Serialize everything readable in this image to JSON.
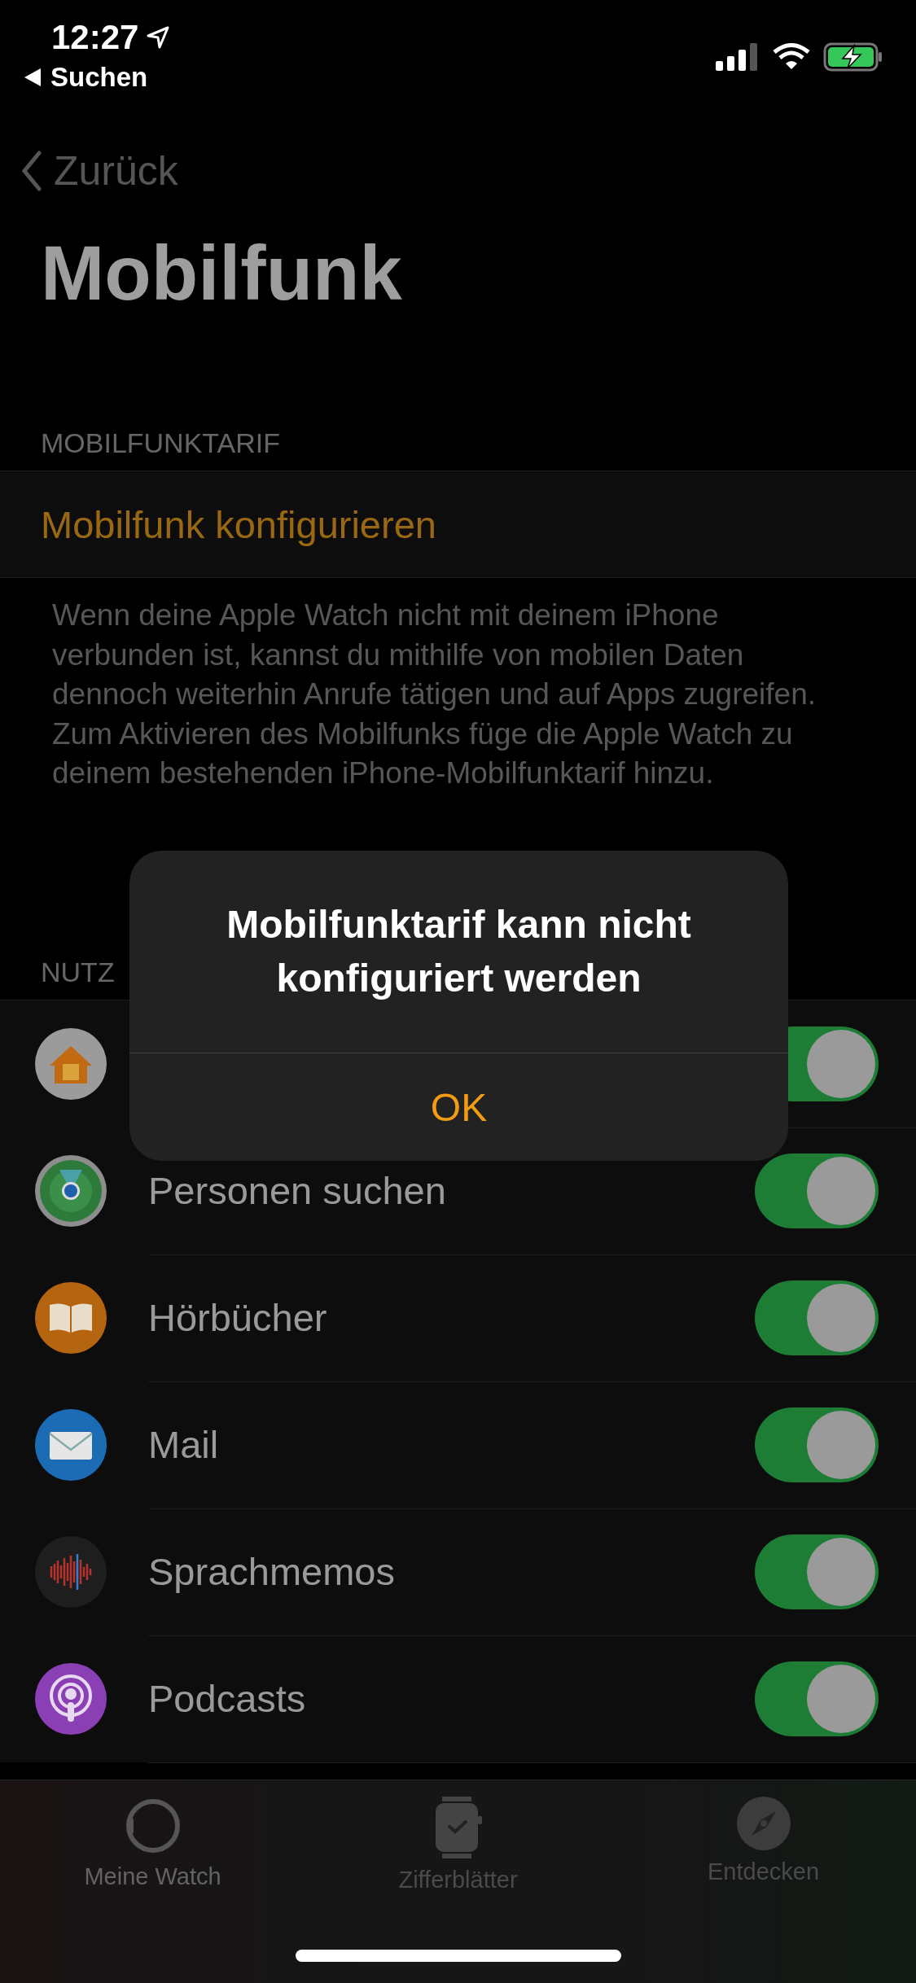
{
  "status_bar": {
    "time": "12:27",
    "back_app": "Suchen"
  },
  "nav": {
    "back": "Zurück"
  },
  "title": "Mobilfunk",
  "plan_section": {
    "header": "MOBILFUNKTARIF",
    "action": "Mobilfunk konfigurieren",
    "footer": "Wenn deine Apple Watch nicht mit deinem iPhone verbunden ist, kannst du mithilfe von mobilen Daten dennoch weiterhin Anrufe tätigen und auf Apps zugreifen. Zum Aktivieren des Mobilfunks füge die Apple Watch zu deinem bestehenden iPhone-Mobilfunktarif hinzu."
  },
  "usage_section": {
    "header": "NUTZ",
    "apps": [
      {
        "on": true
      },
      {
        "label": "Personen suchen",
        "on": true
      },
      {
        "label": "Hörbücher",
        "on": true
      },
      {
        "label": "Mail",
        "on": true
      },
      {
        "label": "Sprachmemos",
        "on": true
      },
      {
        "label": "Podcasts",
        "on": true
      }
    ]
  },
  "alert": {
    "title": "Mobilfunktarif kann nicht konfiguriert werden",
    "button": "OK"
  },
  "tabs": [
    {
      "label": "Meine Watch",
      "selected": true
    },
    {
      "label": "Zifferblätter",
      "selected": false
    },
    {
      "label": "Entdecken",
      "selected": false
    }
  ]
}
